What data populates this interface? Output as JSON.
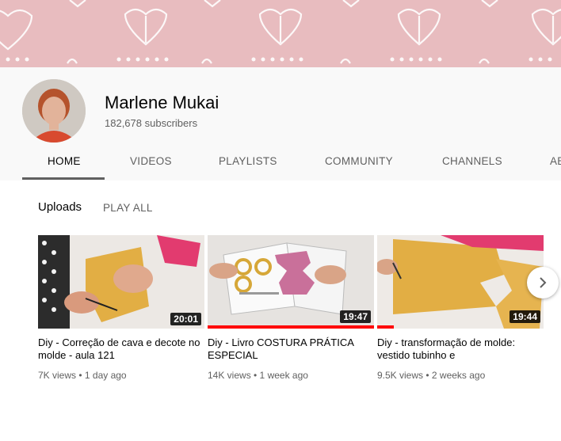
{
  "channel": {
    "name": "Marlene Mukai",
    "subscribers": "182,678 subscribers"
  },
  "tabs": [
    {
      "label": "HOME",
      "active": true
    },
    {
      "label": "VIDEOS",
      "active": false
    },
    {
      "label": "PLAYLISTS",
      "active": false
    },
    {
      "label": "COMMUNITY",
      "active": false
    },
    {
      "label": "CHANNELS",
      "active": false
    },
    {
      "label": "AB",
      "active": false
    }
  ],
  "section": {
    "title": "Uploads",
    "play_all": "PLAY ALL"
  },
  "videos": [
    {
      "title": "Diy - Correção de cava e decote no molde - aula 121",
      "meta": "7K views • 1 day ago",
      "duration": "20:01",
      "watched_fraction": 0
    },
    {
      "title": "Diy - Livro COSTURA PRÁTICA ESPECIAL",
      "meta": "14K views • 1 week ago",
      "duration": "19:47",
      "watched_fraction": 1.0
    },
    {
      "title": "Diy - transformação de molde: vestido tubinho e",
      "meta": "9.5K views • 2 weeks ago",
      "duration": "19:44",
      "watched_fraction": 0.1
    }
  ],
  "colors": {
    "banner": "#e8bcbf",
    "progress": "#ff0000"
  },
  "icons": {
    "next": "chevron-right-icon"
  }
}
